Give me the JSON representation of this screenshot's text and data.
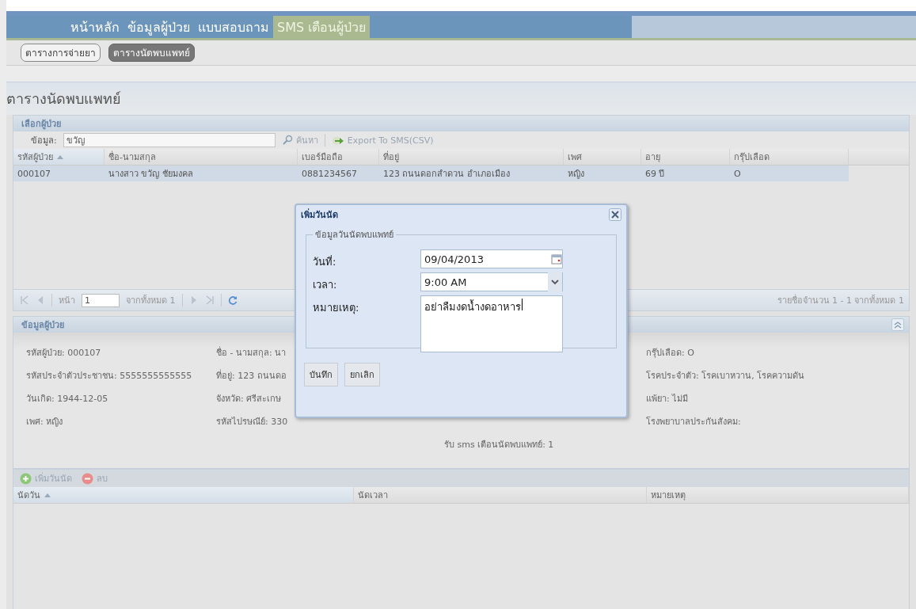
{
  "nav": [
    {
      "label": "หน้าหลัก",
      "selected": false
    },
    {
      "label": "ข้อมูลผู้ป่วย",
      "selected": false
    },
    {
      "label": "แบบสอบถาม",
      "selected": false
    },
    {
      "label": "SMS เตือนผู้ป่วย",
      "selected": true
    }
  ],
  "subtabs": [
    {
      "label": "ตารางการจ่ายยา",
      "selected": false
    },
    {
      "label": "ตารางนัดพบแพทย์",
      "selected": true
    }
  ],
  "page_title": "ตารางนัดพบแพทย์",
  "patient_picker": {
    "title": "เลือกผู้ป่วย",
    "search": {
      "label": "ข้อมูล:",
      "value": "ขวัญ"
    },
    "search_button": "ค้นหา",
    "export_button": "Export To SMS(CSV)",
    "columns": [
      {
        "label": "รหัสผู้ป่วย",
        "sorted": true
      },
      {
        "label": "ชื่อ-นามสกุล",
        "sorted": false
      },
      {
        "label": "เบอร์มือถือ",
        "sorted": false
      },
      {
        "label": "ที่อยู่",
        "sorted": false
      },
      {
        "label": "เพศ",
        "sorted": false
      },
      {
        "label": "อายุ",
        "sorted": false
      },
      {
        "label": "กรุ๊ปเลือด",
        "sorted": false
      }
    ],
    "rows": [
      {
        "selected": true,
        "cells": [
          "000107",
          "นางสาว ขวัญ ชัยมงคล",
          "0881234567",
          "123 ถนนดอกสำดวน อำเภอเมือง",
          "หญิง",
          "69 ปี",
          "O"
        ]
      }
    ],
    "pager": {
      "page_label": "หน้า",
      "page": "1",
      "of_total": "จากทั้งหมด 1",
      "summary": "รายชื่อจำนวน 1 - 1 จากทั้งหมด 1"
    }
  },
  "patient_info": {
    "title": "ข้อมูลผู้ป่วย",
    "columns": [
      [
        "รหัสผู้ป่วย: 000107",
        "รหัสประจำตัวประชาชน: 5555555555555",
        "วันเกิด: 1944-12-05",
        "เพศ: หญิง"
      ],
      [
        "ชื่อ - นามสกุล: นา",
        "ที่อยู่: 123 ถนนดอ",
        "จังหวัด: ศรีสะเกษ",
        "รหัสไปรษณีย์: 330"
      ],
      [
        "",
        "",
        "",
        "",
        "รับ sms เตือนนัดพบแพทย์: 1"
      ],
      [
        "กรุ๊ปเลือด: O",
        "โรคประจำตัว: โรคเบาหวาน, โรคความดัน",
        "แพ้ยา: ไม่มี",
        "โรงพยาบาลประกันสังคม:"
      ]
    ]
  },
  "appointments": {
    "add_button": "เพิ่มวันนัด",
    "delete_button": "ลบ",
    "columns": [
      {
        "label": "นัดวัน",
        "sorted": true
      },
      {
        "label": "นัดเวลา",
        "sorted": false
      },
      {
        "label": "หมายเหตุ",
        "sorted": false
      }
    ]
  },
  "dialog": {
    "title": "เพิ่มวันนัด",
    "legend": "ข้อมูลวันนัดพบแพทย์",
    "fields": [
      {
        "kind": "date",
        "label": "วันที่:",
        "value": "09/04/2013"
      },
      {
        "kind": "select",
        "label": "เวลา:",
        "value": "9:00 AM"
      },
      {
        "kind": "textarea",
        "label": "หมายเหตุ:",
        "value": "อย่าลืมงดน้ำงดอาหาร"
      }
    ],
    "buttons": [
      "บันทึก",
      "ยกเลิก"
    ]
  }
}
